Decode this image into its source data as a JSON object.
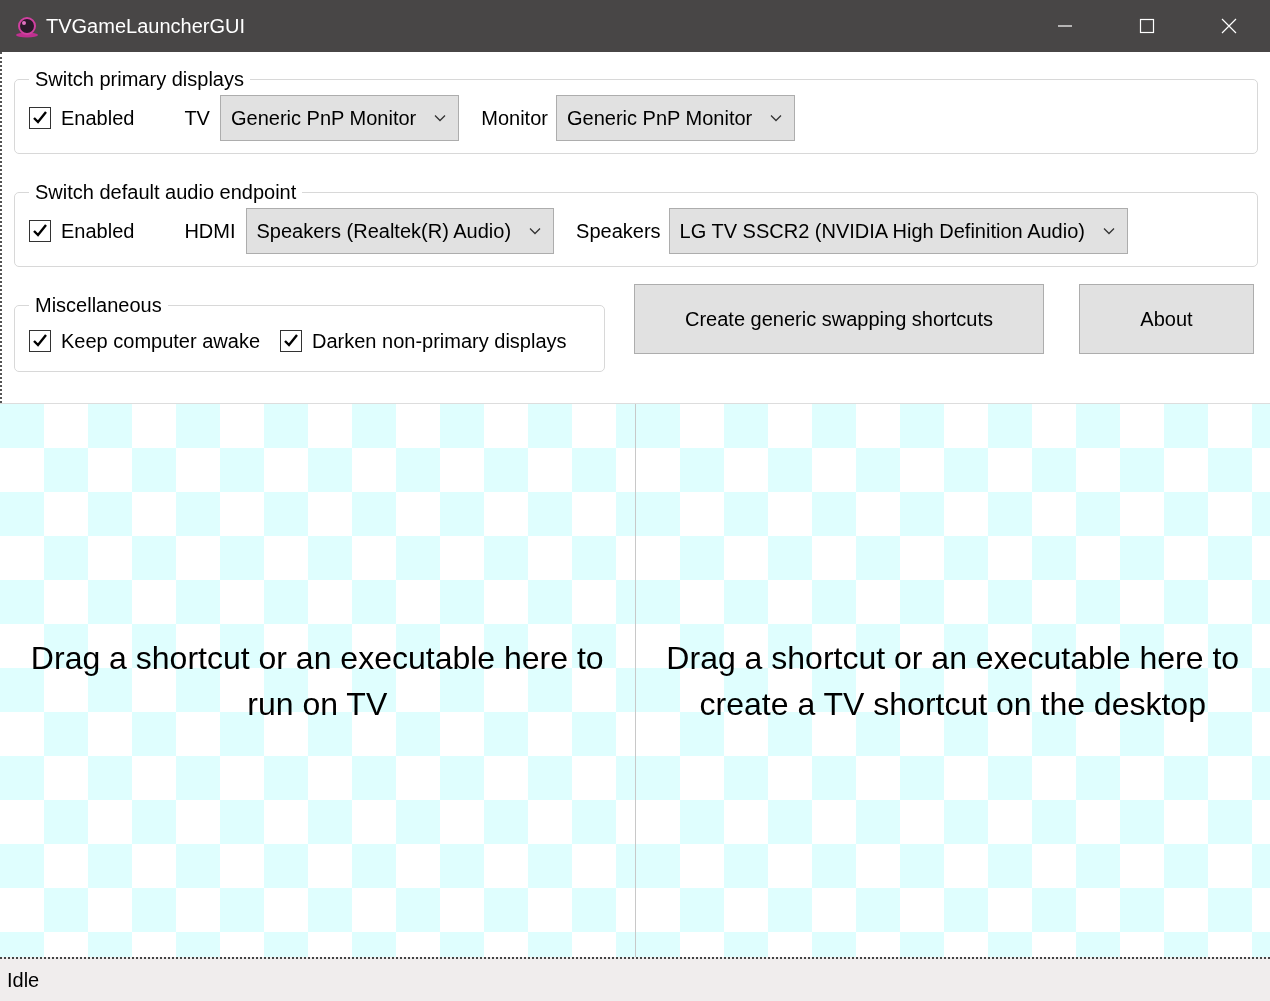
{
  "window": {
    "title": "TVGameLauncherGUI"
  },
  "groups": [
    {
      "title": "Switch primary displays",
      "enabled": {
        "label": "Enabled",
        "checked": true
      },
      "selectors": [
        {
          "label": "TV",
          "value": "Generic PnP Monitor"
        },
        {
          "label": "Monitor",
          "value": "Generic PnP Monitor"
        }
      ]
    },
    {
      "title": "Switch default audio endpoint",
      "enabled": {
        "label": "Enabled",
        "checked": true
      },
      "selectors": [
        {
          "label": "HDMI",
          "value": "Speakers (Realtek(R) Audio)"
        },
        {
          "label": "Speakers",
          "value": "LG TV SSCR2 (NVIDIA High Definition Audio)"
        }
      ]
    }
  ],
  "miscellaneous": {
    "title": "Miscellaneous",
    "options": [
      {
        "label": "Keep computer awake",
        "checked": true
      },
      {
        "label": "Darken non-primary displays",
        "checked": true
      }
    ]
  },
  "buttons": [
    {
      "label": "Create generic swapping shortcuts",
      "kind": "wide"
    },
    {
      "label": "About",
      "kind": "narrow"
    }
  ],
  "drop_zones": [
    {
      "text": "Drag a shortcut or an executable here to run on TV"
    },
    {
      "text": "Drag a shortcut or an executable here to create a TV shortcut on the desktop"
    }
  ],
  "status_bar": {
    "text": "Idle"
  }
}
